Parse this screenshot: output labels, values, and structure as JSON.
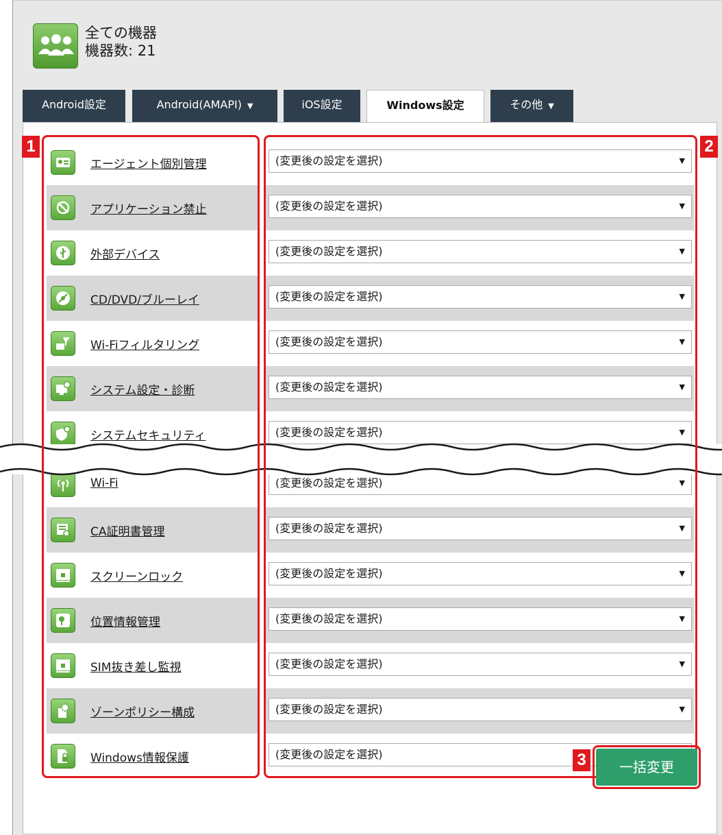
{
  "header": {
    "title": "全ての機器",
    "device_count_label": "機器数: 21"
  },
  "tabs": [
    {
      "label": "Android設定",
      "active": false,
      "dropdown": false
    },
    {
      "label": "Android(AMAPI)",
      "active": false,
      "dropdown": true
    },
    {
      "label": "iOS設定",
      "active": false,
      "dropdown": false
    },
    {
      "label": "Windows設定",
      "active": true,
      "dropdown": false
    },
    {
      "label": "その他",
      "active": false,
      "dropdown": true
    }
  ],
  "select_placeholder": "(変更後の設定を選択)",
  "settings_rows": [
    {
      "label": "エージェント個別管理",
      "icon": "agent-card-icon"
    },
    {
      "label": "アプリケーション禁止",
      "icon": "app-block-icon"
    },
    {
      "label": "外部デバイス",
      "icon": "usb-icon"
    },
    {
      "label": "CD/DVD/ブルーレイ",
      "icon": "disc-icon"
    },
    {
      "label": "Wi-Fiフィルタリング",
      "icon": "wifi-filter-icon"
    },
    {
      "label": "システム設定・診断",
      "icon": "system-diagnostics-icon"
    },
    {
      "label": "システムセキュリティ",
      "icon": "shield-icon"
    },
    {
      "label": "Wi-Fi",
      "icon": "wifi-signal-icon"
    },
    {
      "label": "CA証明書管理",
      "icon": "certificate-icon"
    },
    {
      "label": "スクリーンロック",
      "icon": "screen-lock-icon"
    },
    {
      "label": "位置情報管理",
      "icon": "location-icon"
    },
    {
      "label": "SIM抜き差し監視",
      "icon": "sim-monitor-icon"
    },
    {
      "label": "ゾーンポリシー構成",
      "icon": "gear-document-icon"
    },
    {
      "label": "Windows情報保護",
      "icon": "document-lock-icon"
    }
  ],
  "callouts": [
    "1",
    "2",
    "3"
  ],
  "bulk_change_button": "一括変更",
  "colors": {
    "tab_bg": "#2e3e4d",
    "row_shade": "#d8d8d8",
    "callout_red": "#e0191e",
    "button_green": "#2e9e6b",
    "icon_green": "#5aa83a"
  }
}
